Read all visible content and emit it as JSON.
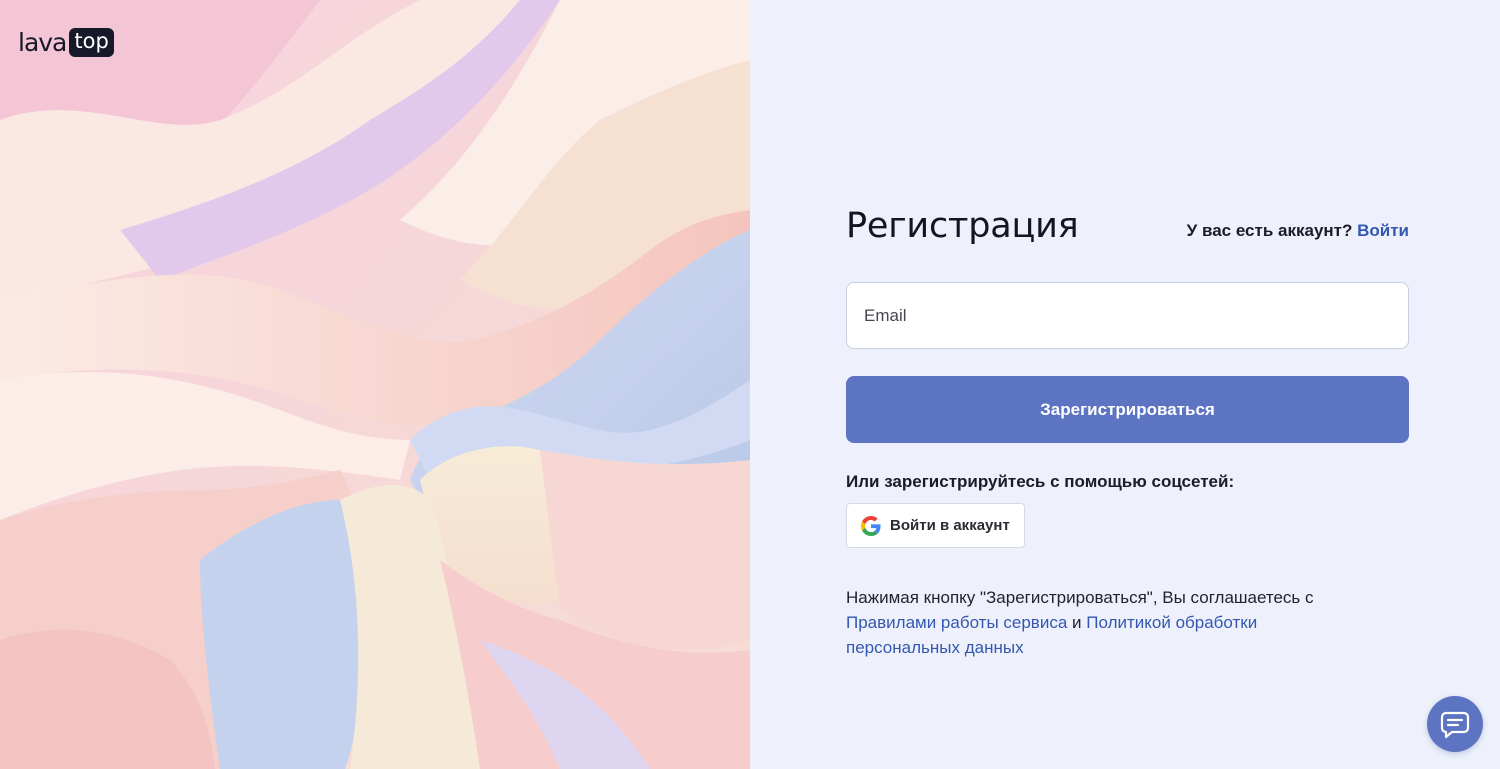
{
  "logo": {
    "part1": "lava",
    "part2": "top"
  },
  "form": {
    "title": "Регистрация",
    "login_question": "У вас есть аккаунт?",
    "login_link": "Войти",
    "email_placeholder": "Email",
    "email_value": "",
    "register_button": "Зарегистрироваться",
    "social_label": "Или зарегистрируйтесь с помощью соцсетей:",
    "google_button": "Войти в аккаунт",
    "terms_prefix": "Нажимая кнопку \"Зарегистрироваться\", Вы соглашаетесь с",
    "terms_link1": "Правилами работы сервиса",
    "terms_and": "и",
    "terms_link2": "Политикой обработки персональных данных"
  },
  "icons": {
    "google": "google-icon",
    "chat": "chat-icon"
  },
  "colors": {
    "primary": "#5c74c2",
    "link": "#3458b0",
    "background": "#eef1fb",
    "text": "#13151f"
  }
}
